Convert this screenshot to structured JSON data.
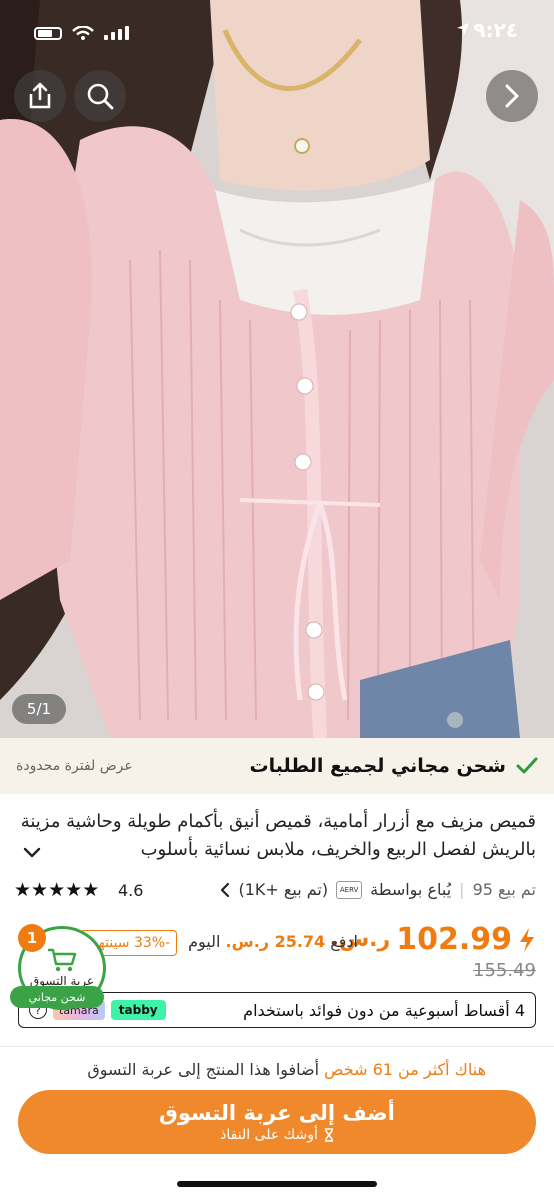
{
  "status_bar": {
    "time": "٩:٢٤"
  },
  "hero": {
    "image_counter": "5/1"
  },
  "shipping": {
    "text": "شحن مجاني لجميع الطلبات",
    "limited": "عرض لفترة محدودة"
  },
  "product": {
    "title": "قميص مزيف مع أزرار أمامية، قميص أنيق بأكمام طويلة وحاشية مزينة بالريش لفصل الربيع والخريف، ملابس نسائية بأسلوب",
    "rating": "4.6",
    "stars": 5,
    "sold": "تم بيع 95",
    "sold_by": "يُباع بواسطة",
    "seller_logo": "AERV",
    "seller_sold": "(تم بيع +1K)"
  },
  "price": {
    "amount": "102.99",
    "currency": "ر.س.",
    "pay_today_prefix": "ادفع",
    "pay_today_amount": "25.74 ر.س.",
    "pay_today_suffix": "اليوم",
    "discount": "-33% سينتهي",
    "old_price": "155.49"
  },
  "installments": {
    "text": "4 أقساط أسبوعية من دون فوائد باستخدام",
    "tabby": "tabby",
    "tamara": "tamara",
    "help": "?"
  },
  "cart": {
    "count": "1",
    "label": "عربة التسوق",
    "free_shipping": "شحن مجاني"
  },
  "social_proof": {
    "prefix": "هناك أكثر من",
    "highlight": "61 شخص",
    "suffix": "أضافوا هذا المنتج إلى عربة التسوق"
  },
  "cta": {
    "main": "أضف إلى عربة التسوق",
    "sub": "أوشك على النفاذ"
  },
  "colors": {
    "accent": "#f07b10",
    "cta": "#f0882c",
    "green": "#3aa346",
    "ship_bg": "#f6f1e9"
  }
}
